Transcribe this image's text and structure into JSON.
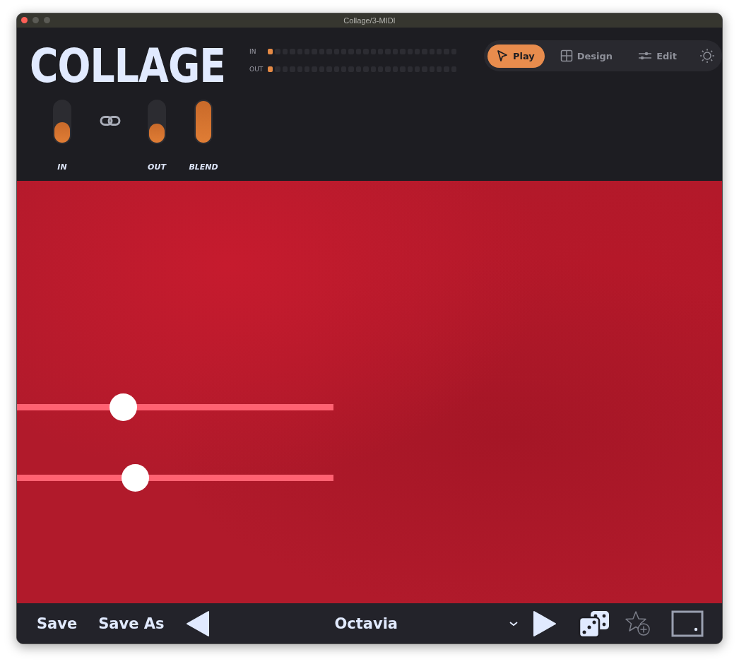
{
  "window": {
    "title": "Collage/3-MIDI"
  },
  "logo": {
    "text": "COLLAGE"
  },
  "meters": [
    {
      "label": "IN",
      "level": 0.04
    },
    {
      "label": "OUT",
      "level": 0.04
    }
  ],
  "faders": [
    {
      "label": "IN",
      "level": 0.5
    },
    {
      "label": "OUT",
      "level": 0.45
    },
    {
      "label": "BLEND",
      "level": 1
    }
  ],
  "link": {
    "on": true
  },
  "modes": [
    {
      "label": "Play",
      "kind": "play",
      "selected": true
    },
    {
      "label": "Design",
      "kind": "design",
      "selected": false
    },
    {
      "label": "Edit",
      "kind": "edit",
      "selected": false
    }
  ],
  "canvas": {
    "sliders": [
      {
        "level": 0.335
      },
      {
        "level": 0.373
      }
    ]
  },
  "bottom_bar": {
    "save": "Save",
    "save_as": "Save As",
    "preset": "Octavia"
  }
}
